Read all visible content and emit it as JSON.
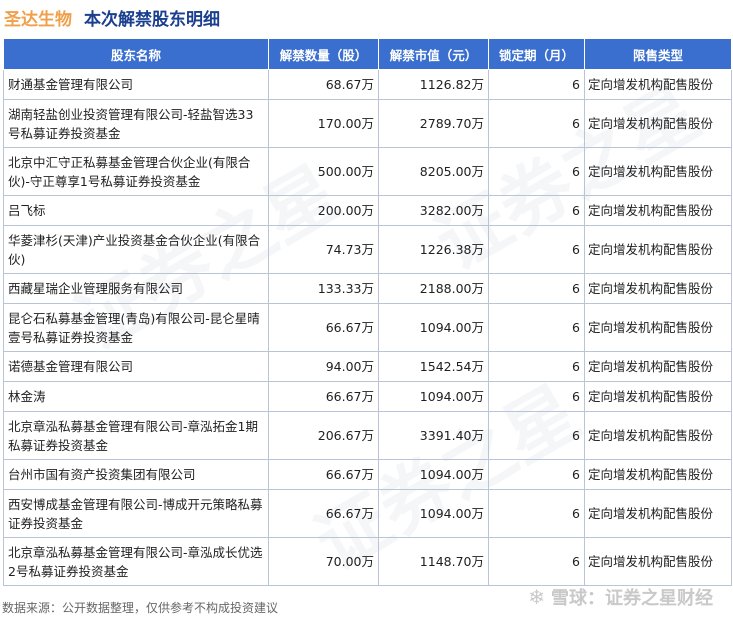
{
  "header": {
    "stock_name": "圣达生物",
    "title": "本次解禁股东明细"
  },
  "table": {
    "columns": [
      "股东名称",
      "解禁数量（股）",
      "解禁市值（元）",
      "锁定期（月）",
      "限售类型"
    ],
    "rows": [
      {
        "holder": "财通基金管理有限公司",
        "shares": "68.67万",
        "value": "1126.82万",
        "lock": "6",
        "type": "定向增发机构配售股份"
      },
      {
        "holder": "湖南轻盐创业投资管理有限公司-轻盐智选33号私募证券投资基金",
        "shares": "170.00万",
        "value": "2789.70万",
        "lock": "6",
        "type": "定向增发机构配售股份"
      },
      {
        "holder": "北京中汇守正私募基金管理合伙企业(有限合伙)-守正尊享1号私募证券投资基金",
        "shares": "500.00万",
        "value": "8205.00万",
        "lock": "6",
        "type": "定向增发机构配售股份"
      },
      {
        "holder": "吕飞标",
        "shares": "200.00万",
        "value": "3282.00万",
        "lock": "6",
        "type": "定向增发机构配售股份"
      },
      {
        "holder": "华菱津杉(天津)产业投资基金合伙企业(有限合伙)",
        "shares": "74.73万",
        "value": "1226.38万",
        "lock": "6",
        "type": "定向增发机构配售股份"
      },
      {
        "holder": "西藏星瑞企业管理服务有限公司",
        "shares": "133.33万",
        "value": "2188.00万",
        "lock": "6",
        "type": "定向增发机构配售股份"
      },
      {
        "holder": "昆仑石私募基金管理(青岛)有限公司-昆仑星晴壹号私募证券投资基金",
        "shares": "66.67万",
        "value": "1094.00万",
        "lock": "6",
        "type": "定向增发机构配售股份"
      },
      {
        "holder": "诺德基金管理有限公司",
        "shares": "94.00万",
        "value": "1542.54万",
        "lock": "6",
        "type": "定向增发机构配售股份"
      },
      {
        "holder": "林金涛",
        "shares": "66.67万",
        "value": "1094.00万",
        "lock": "6",
        "type": "定向增发机构配售股份"
      },
      {
        "holder": "北京章泓私募基金管理有限公司-章泓拓金1期私募证券投资基金",
        "shares": "206.67万",
        "value": "3391.40万",
        "lock": "6",
        "type": "定向增发机构配售股份"
      },
      {
        "holder": "台州市国有资产投资集团有限公司",
        "shares": "66.67万",
        "value": "1094.00万",
        "lock": "6",
        "type": "定向增发机构配售股份"
      },
      {
        "holder": "西安博成基金管理有限公司-博成开元策略私募证券投资基金",
        "shares": "66.67万",
        "value": "1094.00万",
        "lock": "6",
        "type": "定向增发机构配售股份"
      },
      {
        "holder": "北京章泓私募基金管理有限公司-章泓成长优选2号私募证券投资基金",
        "shares": "70.00万",
        "value": "1148.70万",
        "lock": "6",
        "type": "定向增发机构配售股份"
      }
    ]
  },
  "footer": {
    "source": "数据来源：公开数据整理，仅供参考不构成投资建议"
  },
  "brand": {
    "icon": "snowball-icon",
    "text": "雪球：证券之星财经"
  },
  "watermark": {
    "text": "证券之星"
  },
  "colors": {
    "header_bg": "#3a6fcf",
    "stock_name": "#f0a04a",
    "title": "#1a3f8f"
  }
}
